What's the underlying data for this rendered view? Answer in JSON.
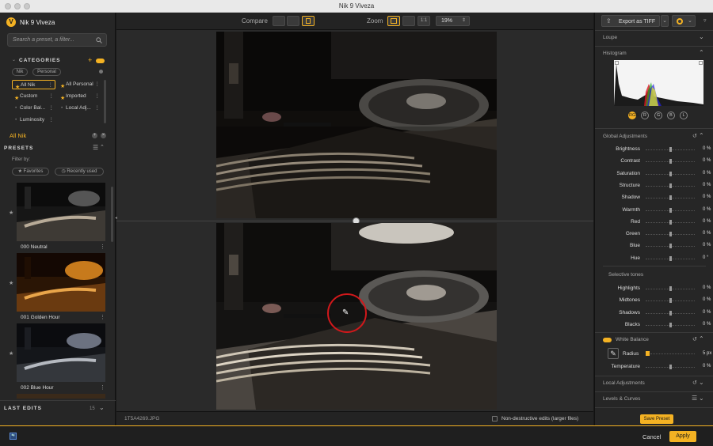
{
  "window": {
    "title": "Nik 9 Viveza"
  },
  "app": {
    "name": "Nik 9 Viveza"
  },
  "search": {
    "placeholder": "Search a preset, a filter..."
  },
  "categories": {
    "header": "CATEGORIES",
    "filters": [
      "Nik",
      "Personal"
    ],
    "items": [
      {
        "label": "All Nik"
      },
      {
        "label": "All Personal"
      },
      {
        "label": "Custom"
      },
      {
        "label": "Imported"
      },
      {
        "label": "Color Bal..."
      },
      {
        "label": "Local Adj..."
      },
      {
        "label": "Luminosity"
      }
    ],
    "selected": "All Nik"
  },
  "presets": {
    "header": "PRESETS",
    "filter_by": "Filter by:",
    "favorites": "★ Favorites",
    "recently_used": "◷ Recently used",
    "items": [
      {
        "label": "000 Neutral"
      },
      {
        "label": "001 Golden Hour"
      },
      {
        "label": "002 Blue Hour"
      }
    ]
  },
  "last_edits": {
    "header": "LAST EDITS",
    "count": "15"
  },
  "toolbar": {
    "compare": "Compare",
    "zoom": "Zoom",
    "zoom_1to1": "1:1",
    "zoom_value": "19%"
  },
  "status": {
    "filename": "1T5A4269.JPG",
    "nondestructive": "Non-destructive edits (larger files)"
  },
  "export": {
    "label": "Export as TIFF"
  },
  "right": {
    "loupe": "Loupe",
    "histogram": "Histogram",
    "channels": [
      "RGB",
      "R",
      "G",
      "B",
      "L"
    ],
    "global_adjustments": "Global Adjustments",
    "sliders": [
      {
        "label": "Brightness",
        "value": "0 %"
      },
      {
        "label": "Contrast",
        "value": "0 %"
      },
      {
        "label": "Saturation",
        "value": "0 %"
      },
      {
        "label": "Structure",
        "value": "0 %"
      },
      {
        "label": "Shadow",
        "value": "0 %"
      },
      {
        "label": "Warmth",
        "value": "0 %"
      },
      {
        "label": "Red",
        "value": "0 %"
      },
      {
        "label": "Green",
        "value": "0 %"
      },
      {
        "label": "Blue",
        "value": "0 %"
      },
      {
        "label": "Hue",
        "value": "0 °"
      }
    ],
    "selective_tones": "Selective tones",
    "tones": [
      {
        "label": "Highlights",
        "value": "0 %"
      },
      {
        "label": "Midtones",
        "value": "0 %"
      },
      {
        "label": "Shadows",
        "value": "0 %"
      },
      {
        "label": "Blacks",
        "value": "0 %"
      }
    ],
    "white_balance": "White Balance",
    "radius": {
      "label": "Radius",
      "value": "5 px"
    },
    "temperature": {
      "label": "Temperature",
      "value": "0 %"
    },
    "local_adjustments": "Local Adjustments",
    "levels_curves": "Levels & Curves",
    "save_preset": "Save Preset"
  },
  "footer": {
    "cancel": "Cancel",
    "apply": "Apply"
  },
  "colors": {
    "accent": "#f4b223",
    "panel": "#262626",
    "background": "#1a1a1a"
  }
}
